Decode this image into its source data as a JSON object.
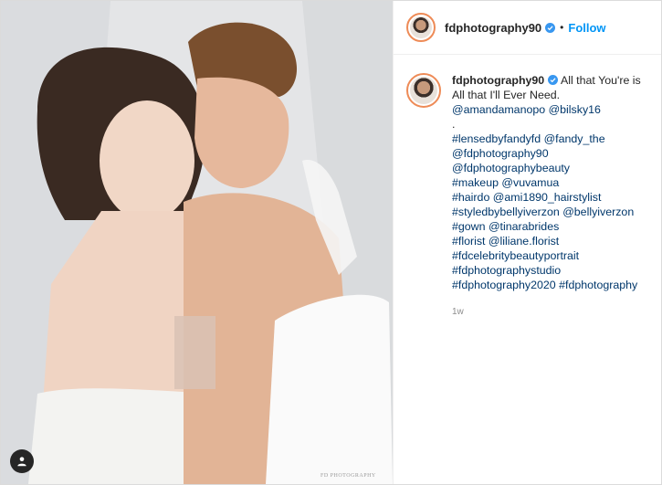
{
  "post": {
    "username": "fdphotography90",
    "follow_label": "Follow",
    "separator": "•",
    "watermark": "FD PHOTOGRAPHY",
    "caption_text": "All that You're is All that I'll Ever Need.",
    "caption_lines": [
      "@amandamanopo @bilsky16",
      ".",
      "#lensedbyfandyfd @fandy_the",
      "@fdphotography90",
      "@fdphotographybeauty",
      "#makeup @vuvamua",
      "#hairdo @ami1890_hairstylist",
      "#styledbybellyiverzon @bellyiverzon",
      "#gown @tinarabrides",
      "#florist @liliane.florist",
      "#fdcelebritybeautyportrait",
      "#fdphotographystudio",
      "#fdphotography2020 #fdphotography"
    ],
    "time": "1w"
  },
  "colors": {
    "accent": "#0095f6",
    "link": "#00376b",
    "muted": "#8e8e8e",
    "verified": "#3897f0"
  },
  "icons": {
    "verified": "verified-badge-icon",
    "tag": "person-tag-icon"
  }
}
